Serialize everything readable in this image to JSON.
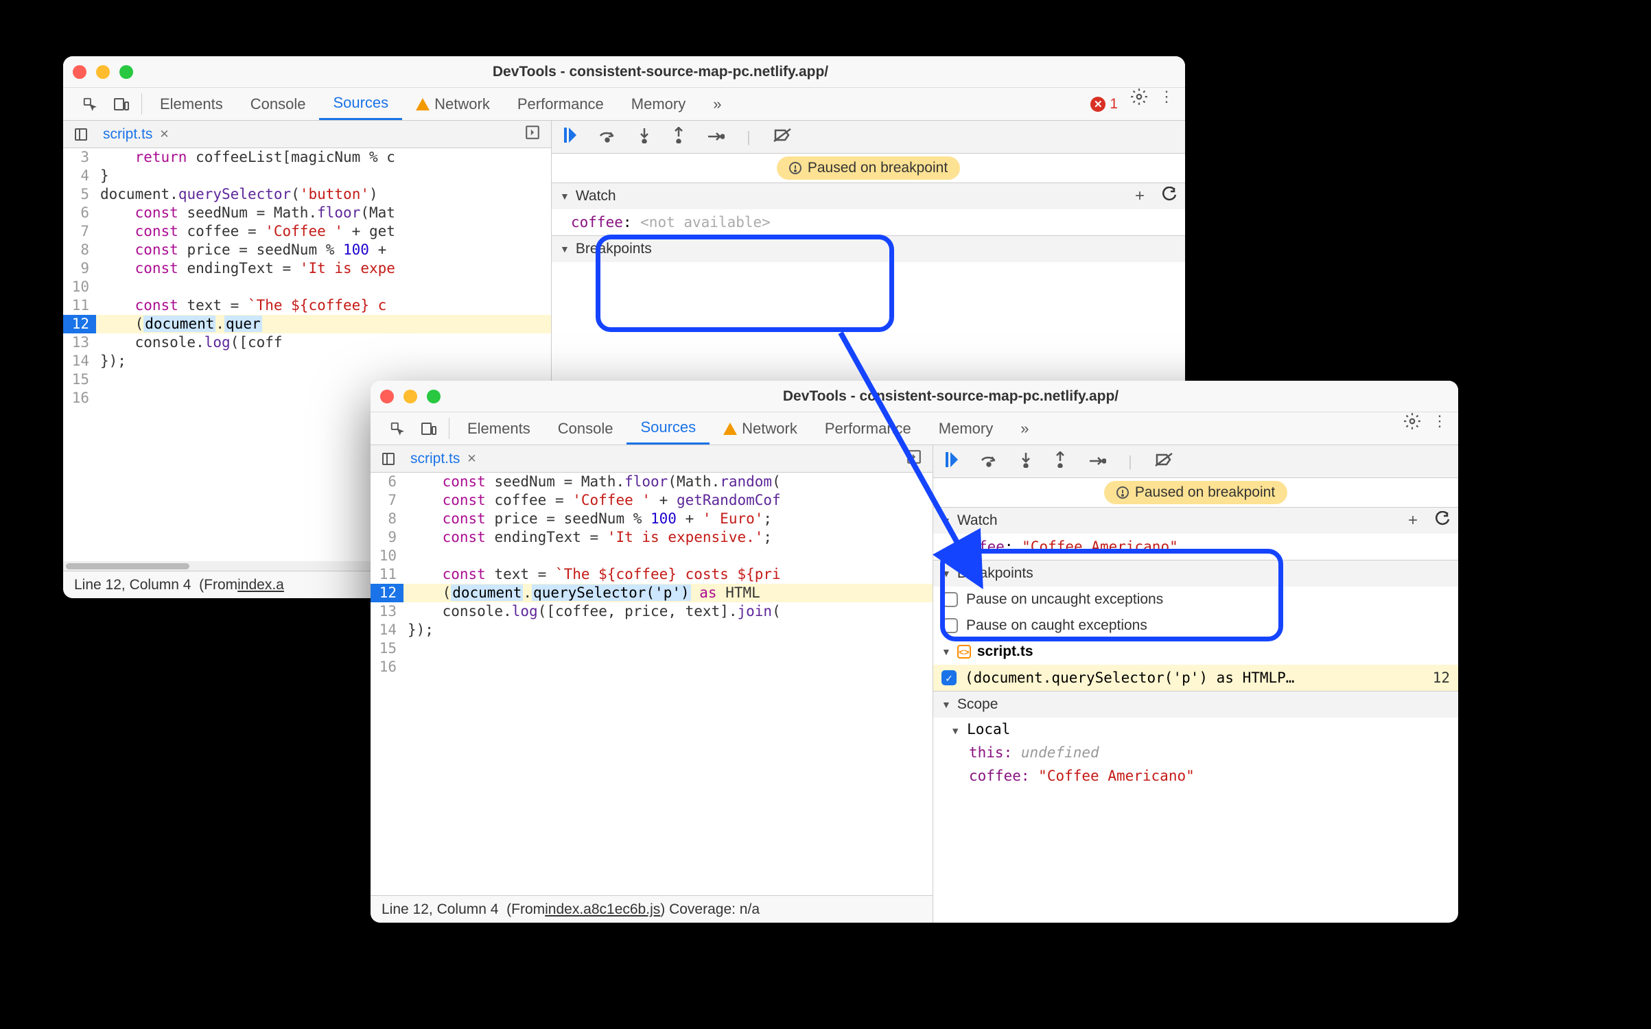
{
  "win1": {
    "title": "DevTools - consistent-source-map-pc.netlify.app/",
    "tabs": [
      "Elements",
      "Console",
      "Sources",
      "Network",
      "Performance",
      "Memory"
    ],
    "err_count": "1",
    "file": "script.ts",
    "lines": [
      {
        "n": "3",
        "pre": "    ",
        "tk": [
          [
            "kw",
            "return"
          ],
          [
            "pu",
            " coffeeList[magicNum % c"
          ]
        ]
      },
      {
        "n": "4",
        "pre": "",
        "tk": [
          [
            "pu",
            "}"
          ]
        ]
      },
      {
        "n": "5",
        "pre": "",
        "tk": [
          [
            "id",
            "document"
          ],
          [
            "pu",
            "."
          ],
          [
            "fn",
            "querySelector"
          ],
          [
            "pu",
            "("
          ],
          [
            "str",
            "'button'"
          ],
          [
            "pu",
            ")"
          ]
        ]
      },
      {
        "n": "6",
        "pre": "    ",
        "tk": [
          [
            "kw",
            "const"
          ],
          [
            "pu",
            " seedNum = "
          ],
          [
            "id",
            "Math"
          ],
          [
            "pu",
            "."
          ],
          [
            "fn",
            "floor"
          ],
          [
            "pu",
            "(Mat"
          ]
        ]
      },
      {
        "n": "7",
        "pre": "    ",
        "tk": [
          [
            "kw",
            "const"
          ],
          [
            "pu",
            " coffee = "
          ],
          [
            "str",
            "'Coffee '"
          ],
          [
            "pu",
            " + get"
          ]
        ]
      },
      {
        "n": "8",
        "pre": "    ",
        "tk": [
          [
            "kw",
            "const"
          ],
          [
            "pu",
            " price = seedNum % "
          ],
          [
            "num",
            "100"
          ],
          [
            "pu",
            " + "
          ]
        ]
      },
      {
        "n": "9",
        "pre": "    ",
        "tk": [
          [
            "kw",
            "const"
          ],
          [
            "pu",
            " endingText = "
          ],
          [
            "str",
            "'It is expe"
          ]
        ]
      },
      {
        "n": "10",
        "pre": "",
        "tk": []
      },
      {
        "n": "11",
        "pre": "    ",
        "tk": [
          [
            "kw",
            "const"
          ],
          [
            "pu",
            " text = "
          ],
          [
            "str",
            "`The ${coffee} c"
          ]
        ]
      },
      {
        "n": "12",
        "pre": "    ",
        "hl": true,
        "tk": [
          [
            "pu",
            "("
          ],
          [
            "sb",
            "document"
          ],
          [
            "pu",
            "."
          ],
          [
            "sb",
            "quer"
          ]
        ]
      },
      {
        "n": "13",
        "pre": "    ",
        "tk": [
          [
            "id",
            "console"
          ],
          [
            "pu",
            "."
          ],
          [
            "fn",
            "log"
          ],
          [
            "pu",
            "([coff"
          ]
        ]
      },
      {
        "n": "14",
        "pre": "",
        "tk": [
          [
            "pu",
            "});"
          ]
        ]
      },
      {
        "n": "15",
        "pre": "",
        "tk": []
      },
      {
        "n": "16",
        "pre": "",
        "tk": []
      }
    ],
    "paused": "Paused on breakpoint",
    "watch": {
      "h": "Watch",
      "var": "coffee",
      "val": "<not available>"
    },
    "bp_h": "Breakpoints",
    "status": {
      "pos": "Line 12, Column 4",
      "from": "(From ",
      "link": "index.a"
    }
  },
  "win2": {
    "title": "DevTools - consistent-source-map-pc.netlify.app/",
    "tabs": [
      "Elements",
      "Console",
      "Sources",
      "Network",
      "Performance",
      "Memory"
    ],
    "file": "script.ts",
    "lines": [
      {
        "n": "6",
        "pre": "    ",
        "tk": [
          [
            "kw",
            "const"
          ],
          [
            "pu",
            " seedNum = "
          ],
          [
            "id",
            "Math"
          ],
          [
            "pu",
            "."
          ],
          [
            "fn",
            "floor"
          ],
          [
            "pu",
            "("
          ],
          [
            "id",
            "Math"
          ],
          [
            "pu",
            "."
          ],
          [
            "fn",
            "random"
          ],
          [
            "pu",
            "("
          ]
        ]
      },
      {
        "n": "7",
        "pre": "    ",
        "tk": [
          [
            "kw",
            "const"
          ],
          [
            "pu",
            " coffee = "
          ],
          [
            "str",
            "'Coffee '"
          ],
          [
            "pu",
            " + "
          ],
          [
            "fn",
            "getRandomCof"
          ]
        ]
      },
      {
        "n": "8",
        "pre": "    ",
        "tk": [
          [
            "kw",
            "const"
          ],
          [
            "pu",
            " price = seedNum % "
          ],
          [
            "num",
            "100"
          ],
          [
            "pu",
            " + "
          ],
          [
            "str",
            "' Euro'"
          ],
          [
            "pu",
            ";"
          ]
        ]
      },
      {
        "n": "9",
        "pre": "    ",
        "tk": [
          [
            "kw",
            "const"
          ],
          [
            "pu",
            " endingText = "
          ],
          [
            "str",
            "'It is expensive.'"
          ],
          [
            "pu",
            ";"
          ]
        ]
      },
      {
        "n": "10",
        "pre": "",
        "tk": []
      },
      {
        "n": "11",
        "pre": "    ",
        "tk": [
          [
            "kw",
            "const"
          ],
          [
            "pu",
            " text = "
          ],
          [
            "str",
            "`The ${coffee} costs ${pri"
          ]
        ]
      },
      {
        "n": "12",
        "pre": "    ",
        "hl": true,
        "tk": [
          [
            "pu",
            "("
          ],
          [
            "sb",
            "document"
          ],
          [
            "pu",
            "."
          ],
          [
            "sb",
            "querySelector('p')"
          ],
          [
            "pu",
            " "
          ],
          [
            "kw",
            "as"
          ],
          [
            "pu",
            " HTML"
          ]
        ]
      },
      {
        "n": "13",
        "pre": "    ",
        "tk": [
          [
            "id",
            "console"
          ],
          [
            "pu",
            "."
          ],
          [
            "fn",
            "log"
          ],
          [
            "pu",
            "([coffee, price, text]."
          ],
          [
            "fn",
            "join"
          ],
          [
            "pu",
            "("
          ]
        ]
      },
      {
        "n": "14",
        "pre": "",
        "tk": [
          [
            "pu",
            "});"
          ]
        ]
      },
      {
        "n": "15",
        "pre": "",
        "tk": []
      },
      {
        "n": "16",
        "pre": "",
        "tk": []
      }
    ],
    "paused": "Paused on breakpoint",
    "watch": {
      "h": "Watch",
      "var": "coffee",
      "val": "\"Coffee Americano\""
    },
    "bp": {
      "h": "Breakpoints",
      "un": "Pause on uncaught exceptions",
      "ca": "Pause on caught exceptions",
      "file": "script.ts",
      "row": "(document.querySelector('p') as HTMLP…",
      "ln": "12"
    },
    "scope": {
      "h": "Scope",
      "local": "Local",
      "this": "this:",
      "this_v": "undefined",
      "coffee": "coffee:",
      "coffee_v": "\"Coffee Americano\""
    },
    "status": {
      "pos": "Line 12, Column 4",
      "from": "(From ",
      "link": "index.a8c1ec6b.js",
      "cov": ") Coverage: n/a"
    }
  }
}
